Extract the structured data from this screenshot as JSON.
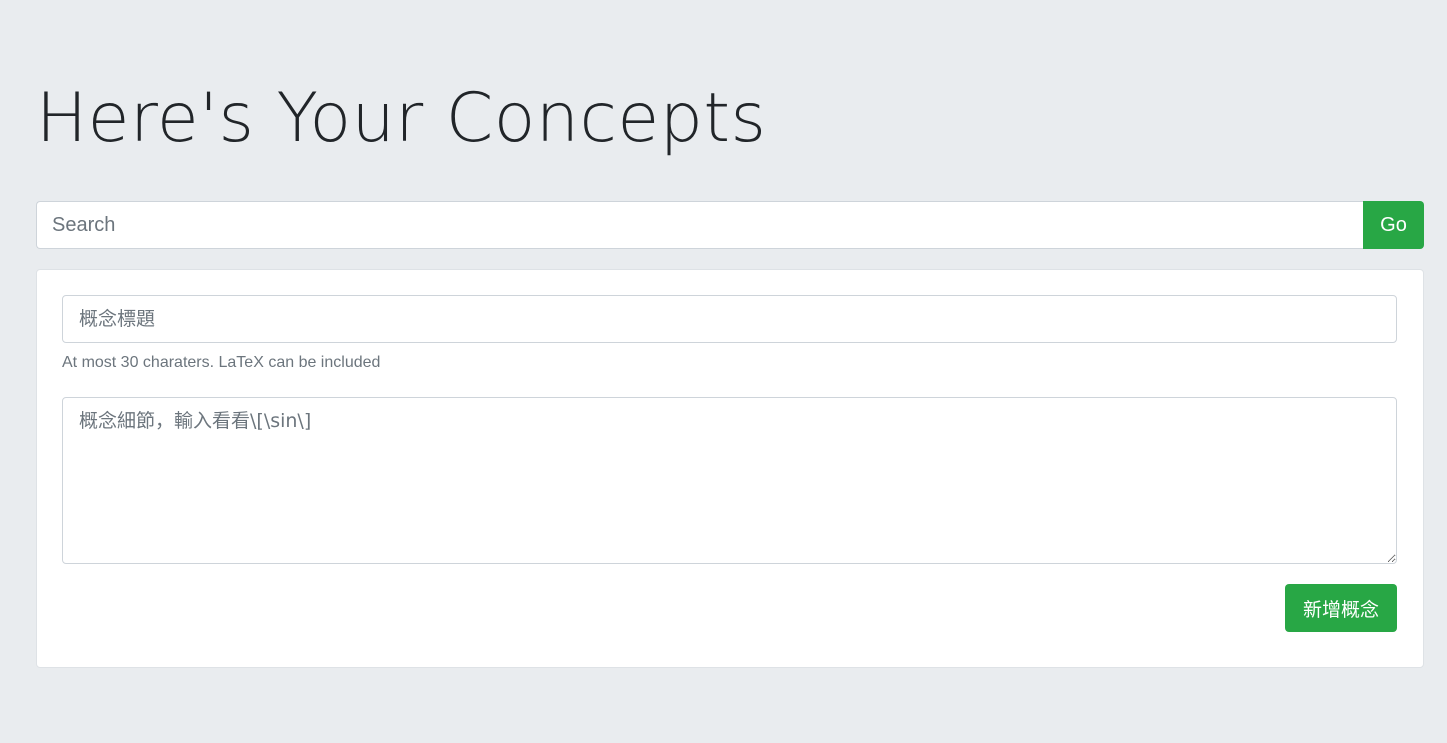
{
  "header": {
    "title": "Here's Your Concepts"
  },
  "search": {
    "placeholder": "Search",
    "value": "",
    "button_label": "Go"
  },
  "concept_form": {
    "title_placeholder": "概念標題",
    "title_value": "",
    "help_text": "At most 30 charaters. LaTeX can be included",
    "detail_placeholder": "概念細節，輸入看看\\[\\sin\\]",
    "detail_value": "",
    "submit_label": "新增概念"
  },
  "colors": {
    "background": "#e9ecef",
    "accent_green": "#28a745",
    "text_dark": "#212529",
    "text_muted": "#6c757d"
  }
}
